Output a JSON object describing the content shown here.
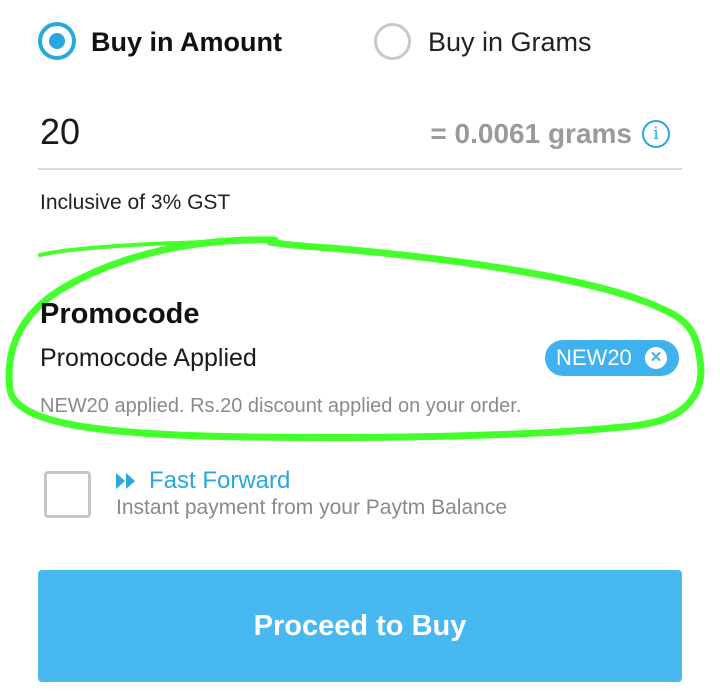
{
  "purchase_mode": {
    "options": [
      {
        "label": "Buy in Amount",
        "selected": true
      },
      {
        "label": "Buy in Grams",
        "selected": false
      }
    ]
  },
  "amount": {
    "value": "20",
    "grams_equivalent": "= 0.0061 grams",
    "info_icon": "info-icon",
    "tax_note": "Inclusive of 3% GST"
  },
  "promocode": {
    "title": "Promocode",
    "status": "Promocode Applied",
    "code": "NEW20",
    "remove_icon": "close-icon",
    "description": "NEW20 applied. Rs.20 discount applied on your order."
  },
  "fast_forward": {
    "checked": false,
    "icon": "fast-forward-icon",
    "title": "Fast Forward",
    "subtitle": "Instant payment from your Paytm Balance"
  },
  "cta": {
    "label": "Proceed to Buy"
  },
  "colors": {
    "accent": "#29a7e1",
    "button": "#48b8f0",
    "highlight": "#45ff2c",
    "muted_text": "#8a8a8a"
  }
}
